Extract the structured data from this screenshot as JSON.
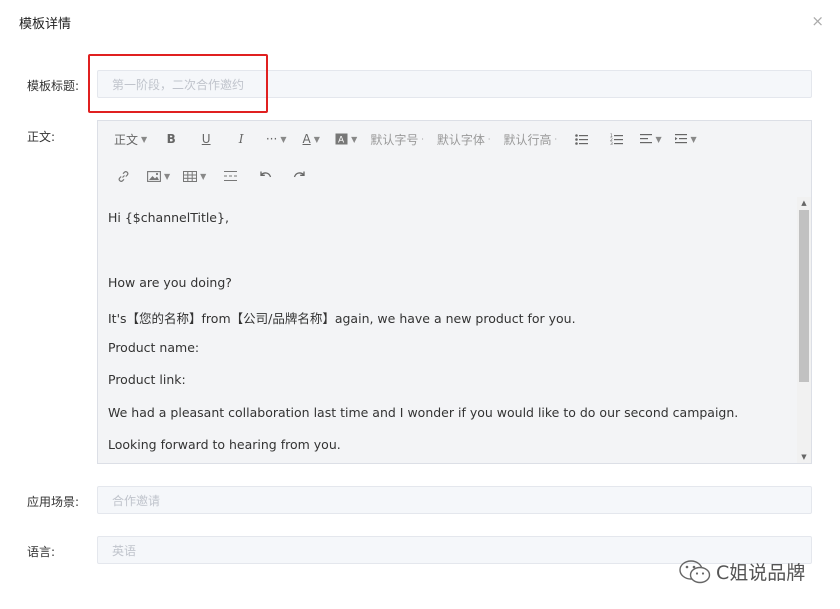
{
  "dialog": {
    "title": "模板详情",
    "close_glyph": "×"
  },
  "form": {
    "title_label": "模板标题:",
    "title_value": "第一阶段，二次合作邀约",
    "body_label": "正文:",
    "scene_label": "应用场景:",
    "scene_value": "合作邀请",
    "language_label": "语言:",
    "language_value": "英语"
  },
  "toolbar": {
    "paragraph": "正文",
    "bold": "B",
    "underline": "U",
    "italic": "I",
    "more": "···",
    "font_color": "A",
    "font_size": "默认字号",
    "font_family": "默认字体",
    "line_height": "默认行高"
  },
  "editor": {
    "lines": [
      "Hi {$channelTitle},",
      "How are you doing?",
      "It's【您的名称】from【公司/品牌名称】again, we have a new product for you.",
      "Product name:",
      "Product link:",
      "We had a pleasant collaboration last time and I wonder if you would like to do our second campaign.",
      "Looking forward to hearing from you."
    ]
  },
  "watermark": {
    "text": "C姐说品牌"
  },
  "colors": {
    "highlight": "#e02020",
    "field_bg": "#f5f7fa",
    "editor_bg": "#f3f4f6"
  }
}
